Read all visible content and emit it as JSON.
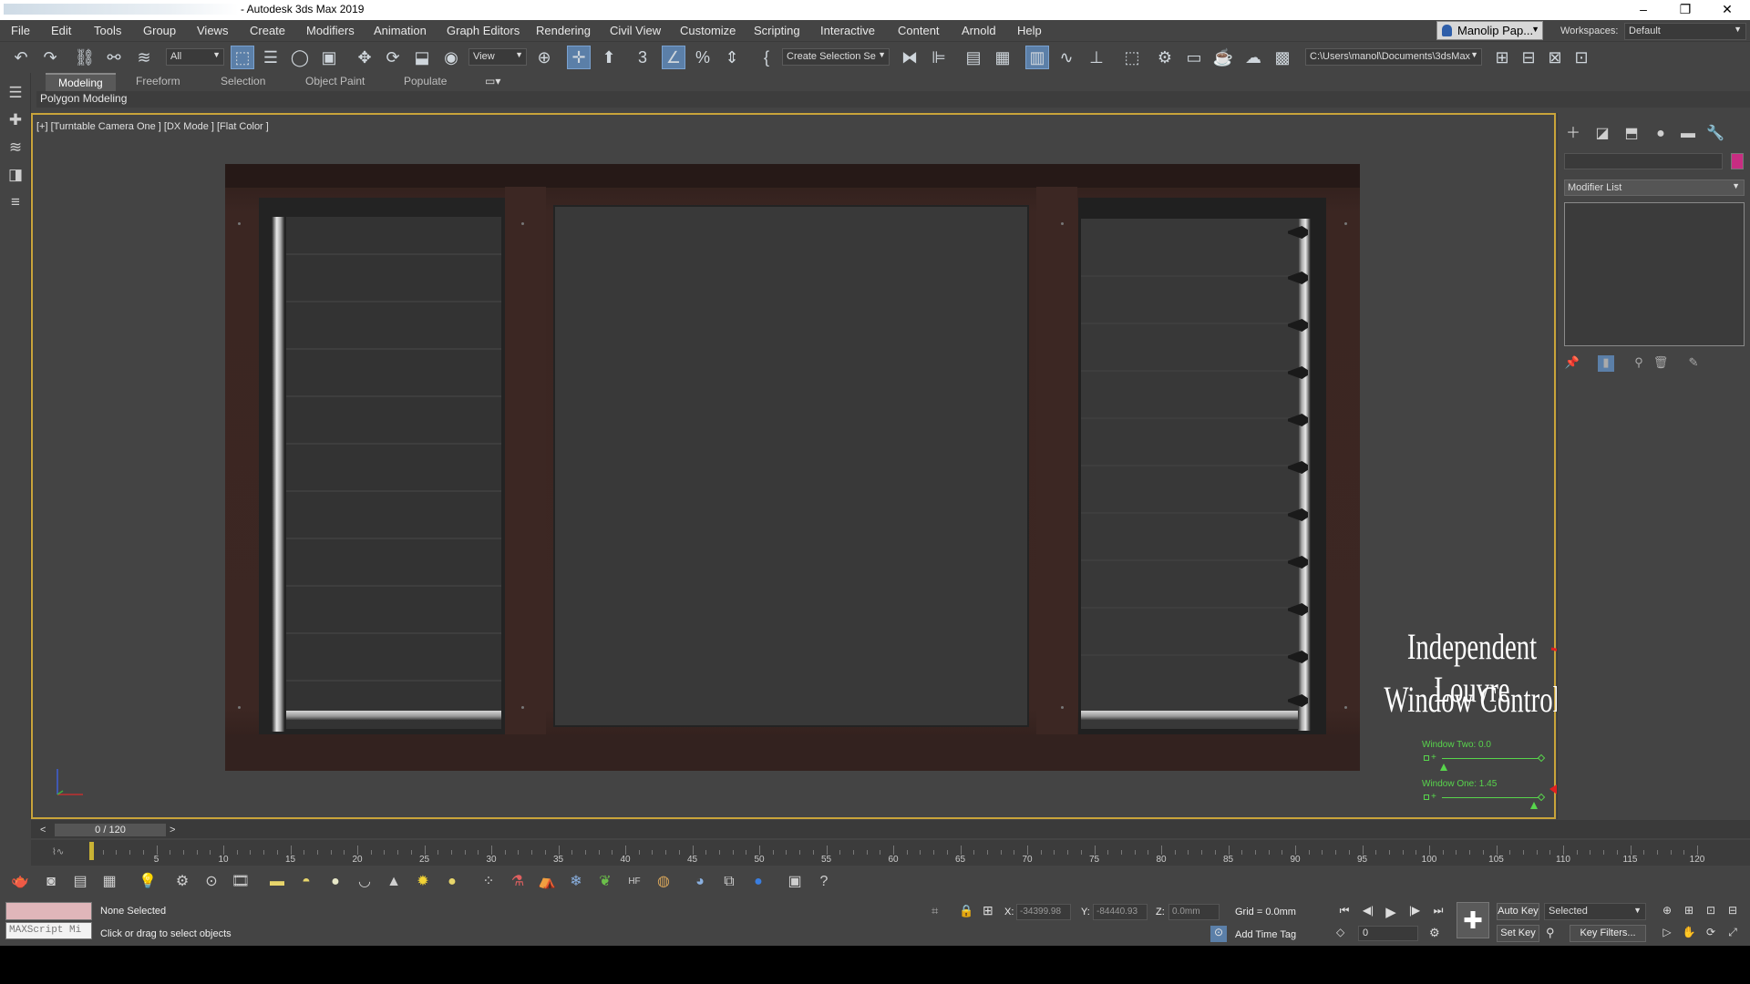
{
  "window": {
    "title": "- Autodesk 3ds Max 2019",
    "minimize": "–",
    "restore": "❐",
    "close": "✕"
  },
  "menu": [
    "File",
    "Edit",
    "Tools",
    "Group",
    "Views",
    "Create",
    "Modifiers",
    "Animation",
    "Graph Editors",
    "Rendering",
    "Civil View",
    "Customize",
    "Scripting",
    "Interactive",
    "Content",
    "Arnold",
    "Help"
  ],
  "user": {
    "name": "Manolip Pap..."
  },
  "workspaces": {
    "label": "Workspaces:",
    "value": "Default"
  },
  "toolbar": {
    "filter": "All",
    "refcoord": "View",
    "named_selection": "Create Selection Se",
    "project_path": "C:\\Users\\manol\\Documents\\3dsMax"
  },
  "ribbon": {
    "tabs": [
      "Modeling",
      "Freeform",
      "Selection",
      "Object Paint",
      "Populate"
    ],
    "active": "Modeling",
    "panel": "Polygon Modeling"
  },
  "viewport": {
    "label": "[+] [Turntable Camera One ] [DX Mode ] [Flat Color ]"
  },
  "annotation": {
    "line1": "Independent Louvre",
    "line2": "Window Control",
    "color": "#e02020"
  },
  "controls": [
    {
      "label": "Window Two: 0.0",
      "value": 0.0
    },
    {
      "label": "Window One: 1.45",
      "value": 1.45
    }
  ],
  "command_panel": {
    "modifier_list": "Modifier List",
    "swatch_color": "#c82d82"
  },
  "timeline": {
    "frame_indicator": "0 / 120",
    "ticks": [
      "5",
      "10",
      "15",
      "20",
      "25",
      "30",
      "35",
      "40",
      "45",
      "50",
      "55",
      "60",
      "65",
      "70",
      "75",
      "80",
      "85",
      "90",
      "95",
      "100",
      "105",
      "110",
      "115",
      "120"
    ]
  },
  "status": {
    "selection": "None Selected",
    "prompt": "Click or drag to select objects",
    "maxscript": "MAXScript Mi",
    "x_label": "X:",
    "x_value": "-34399.98",
    "y_label": "Y:",
    "y_value": "-84440.93",
    "z_label": "Z:",
    "z_value": "0.0mm",
    "grid": "Grid = 0.0mm",
    "add_time_tag": "Add Time Tag",
    "frame": "0",
    "auto_key": "Auto Key",
    "set_key": "Set Key",
    "selected": "Selected",
    "key_filters": "Key Filters..."
  }
}
